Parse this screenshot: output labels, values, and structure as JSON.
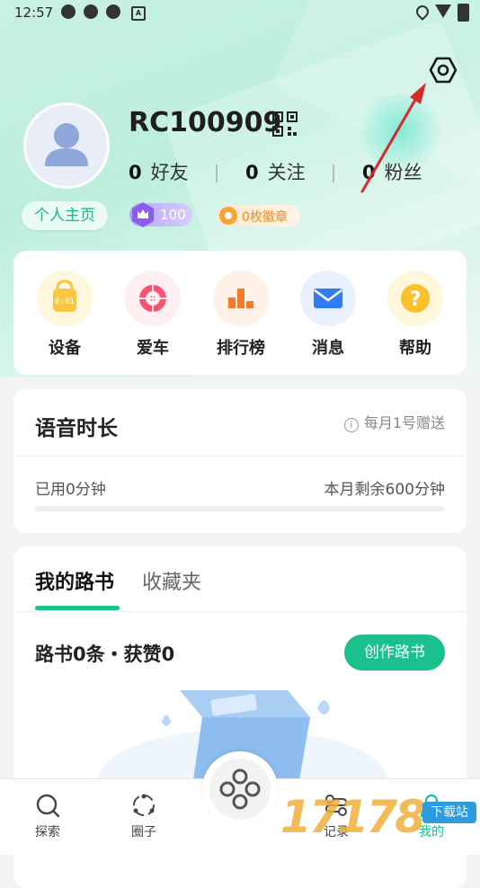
{
  "status": {
    "time": "12:57"
  },
  "profile": {
    "username": "RC100909",
    "friends_count": "0",
    "friends_label": "好友",
    "following_count": "0",
    "following_label": "关注",
    "fans_count": "0",
    "fans_label": "粉丝",
    "homepage_label": "个人主页",
    "level": "100",
    "medals": "0枚徽章"
  },
  "menu": {
    "items": [
      {
        "label": "设备",
        "icon": "device-icon"
      },
      {
        "label": "爱车",
        "icon": "car-wheel-icon"
      },
      {
        "label": "排行榜",
        "icon": "ranking-icon"
      },
      {
        "label": "消息",
        "icon": "message-icon"
      },
      {
        "label": "帮助",
        "icon": "help-icon"
      }
    ]
  },
  "voice": {
    "title": "语音时长",
    "note": "每月1号赠送",
    "used": "已用0分钟",
    "remaining": "本月剩余600分钟",
    "used_fraction": 0
  },
  "routes": {
    "tab_mine": "我的路书",
    "tab_favorites": "收藏夹",
    "summary": "路书0条・获赞0",
    "create_label": "创作路书"
  },
  "nav": {
    "explore": "探索",
    "circle": "圈子",
    "record": "记录",
    "mine": "我的"
  },
  "watermark": {
    "text": "17178",
    "tag": "下载站"
  },
  "colors": {
    "accent": "#19c28e",
    "annotation_arrow": "#d62a2a"
  }
}
